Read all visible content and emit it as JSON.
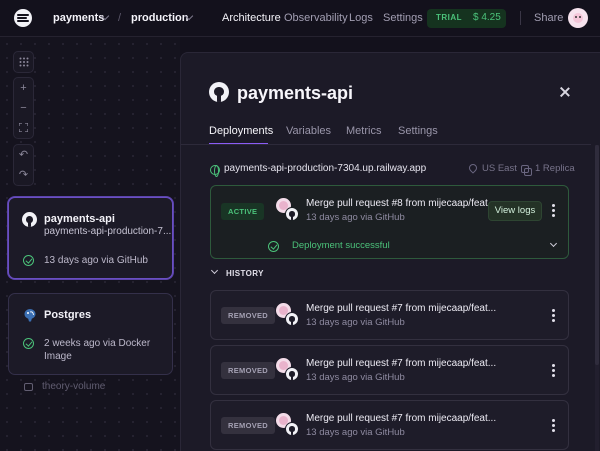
{
  "topbar": {
    "project": "payments",
    "separator": "/",
    "environment": "production",
    "nav": [
      "Architecture",
      "Observability",
      "Logs",
      "Settings"
    ],
    "trial_label": "TRIAL",
    "trial_amount": "$ 4.25",
    "share_label": "Share"
  },
  "canvas": {
    "services": [
      {
        "name": "payments-api",
        "url": "payments-api-production-7...",
        "status": "13 days ago via GitHub"
      },
      {
        "name": "Postgres",
        "status_line1": "2 weeks ago via Docker",
        "status_line2": "Image"
      }
    ],
    "volume": "theory-volume"
  },
  "panel": {
    "title": "payments-api",
    "tabs": [
      "Deployments",
      "Variables",
      "Metrics",
      "Settings"
    ],
    "active_tab": "Deployments",
    "url": "payments-api-production-7304.up.railway.app",
    "region": "US East",
    "replicas": "1 Replica",
    "active_deployment": {
      "badge": "ACTIVE",
      "title": "Merge pull request #8 from mijecaap/feat...",
      "subtitle": "13 days ago via GitHub",
      "view_logs": "View logs",
      "status": "Deployment successful"
    },
    "history_label": "HISTORY",
    "history": [
      {
        "badge": "REMOVED",
        "title": "Merge pull request #7 from mijecaap/feat...",
        "subtitle": "13 days ago via GitHub"
      },
      {
        "badge": "REMOVED",
        "title": "Merge pull request #7 from mijecaap/feat...",
        "subtitle": "13 days ago via GitHub"
      },
      {
        "badge": "REMOVED",
        "title": "Merge pull request #7 from mijecaap/feat...",
        "subtitle": "13 days ago via GitHub"
      }
    ]
  },
  "colors": {
    "background": "#13111c",
    "panel": "#1c1a27",
    "accent": "#8b5cf6",
    "success": "#4bc27a"
  }
}
